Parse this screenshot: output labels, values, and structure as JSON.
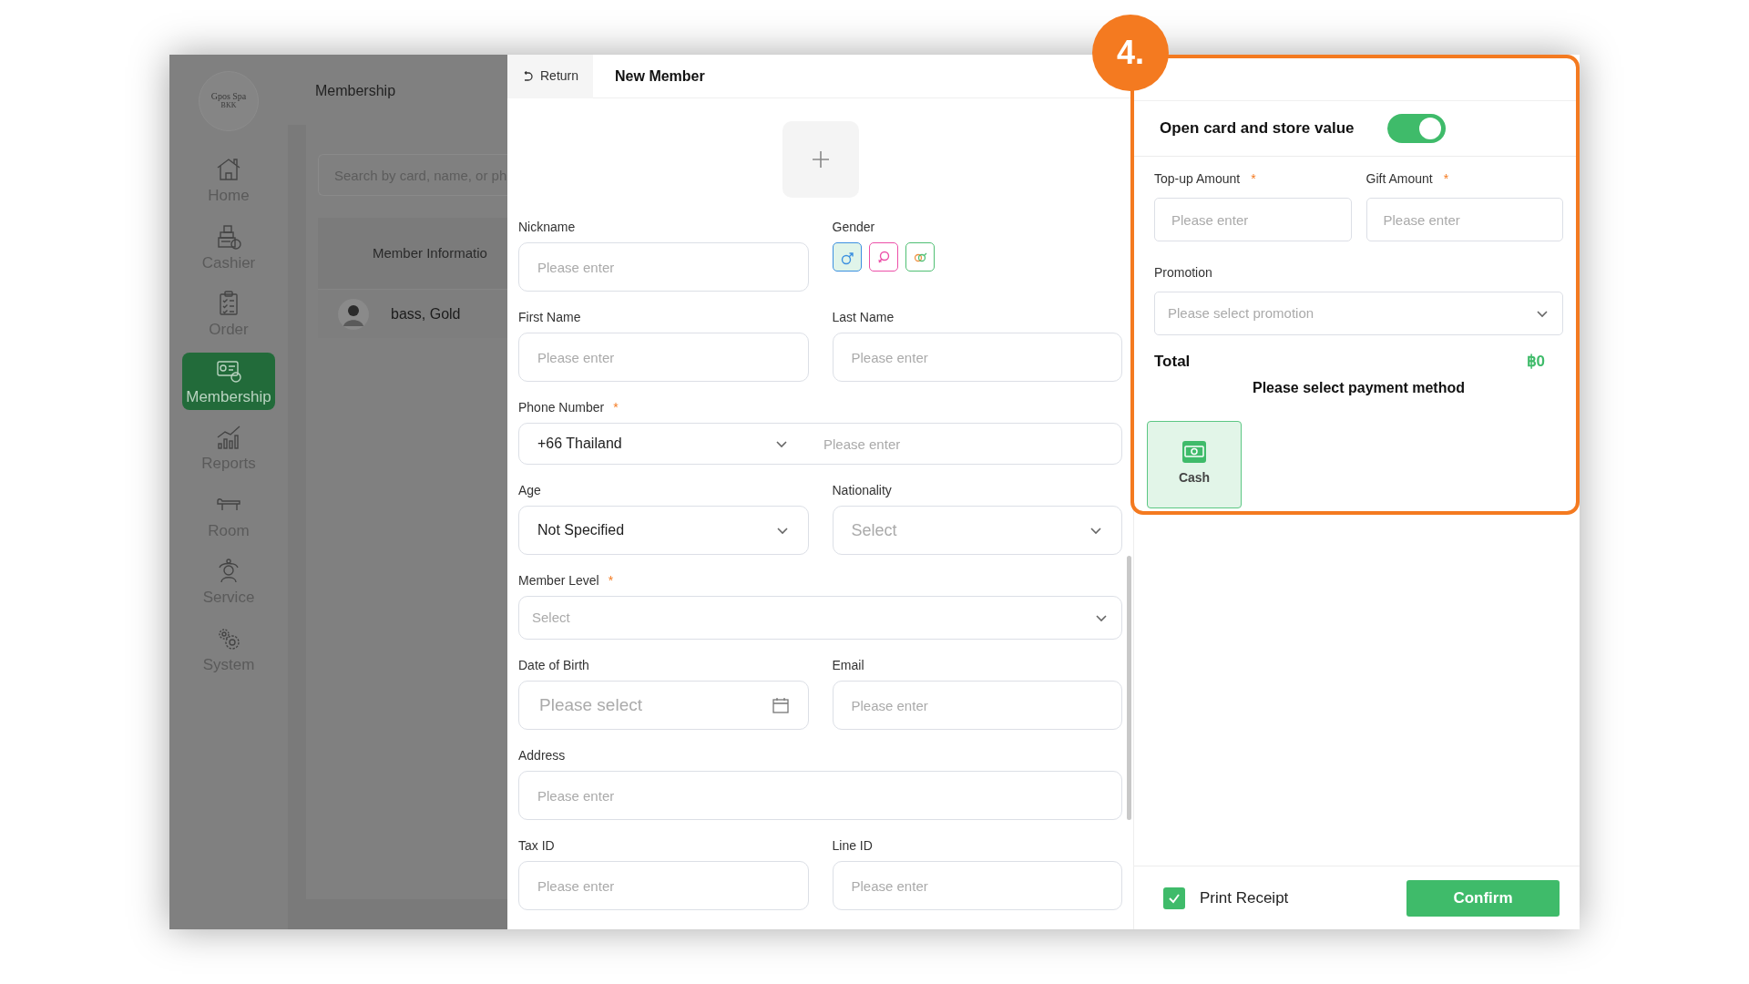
{
  "sidebar": {
    "logo": {
      "title": "Gpos Spa",
      "subtitle": "BKK"
    },
    "items": [
      {
        "kind": "home",
        "label": "Home",
        "selected": false
      },
      {
        "kind": "cashier",
        "label": "Cashier",
        "selected": false
      },
      {
        "kind": "order",
        "label": "Order",
        "selected": false
      },
      {
        "kind": "membership",
        "label": "Membership",
        "selected": true
      },
      {
        "kind": "reports",
        "label": "Reports",
        "selected": false
      },
      {
        "kind": "room",
        "label": "Room",
        "selected": false
      },
      {
        "kind": "service",
        "label": "Service",
        "selected": false
      },
      {
        "kind": "system",
        "label": "System",
        "selected": false
      }
    ]
  },
  "background_page": {
    "title": "Membership",
    "search": {
      "placeholder": "Search by card, name, or ph"
    },
    "table": {
      "columns": [
        "Member Informatio"
      ],
      "rows": [
        {
          "name": "bass, Gold"
        }
      ]
    }
  },
  "form": {
    "return_label": "Return",
    "title": "New Member",
    "rows": [
      {
        "fields": [
          {
            "kind": "text",
            "label": "Nickname",
            "placeholder": "Please enter"
          },
          {
            "kind": "gender",
            "label": "Gender",
            "options": [
              {
                "kind": "male",
                "selected": true,
                "color": "#3b8fe0"
              },
              {
                "kind": "female",
                "selected": false,
                "color": "#ec4fa8"
              },
              {
                "kind": "other",
                "selected": false,
                "color": "#4fbf73"
              }
            ]
          }
        ]
      },
      {
        "fields": [
          {
            "kind": "text",
            "label": "First Name",
            "placeholder": "Please enter"
          },
          {
            "kind": "text",
            "label": "Last Name",
            "placeholder": "Please enter"
          }
        ]
      },
      {
        "fields": [
          {
            "kind": "phone",
            "label": "Phone Number",
            "required_mark": "*",
            "country": "+66 Thailand",
            "placeholder": "Please enter"
          }
        ]
      },
      {
        "fields": [
          {
            "kind": "select",
            "label": "Age",
            "value": "Not Specified"
          },
          {
            "kind": "select",
            "label": "Nationality",
            "placeholder": "Select"
          }
        ]
      },
      {
        "fields": [
          {
            "kind": "select",
            "label": "Member Level",
            "required_mark": "*",
            "placeholder": "Select"
          }
        ]
      },
      {
        "fields": [
          {
            "kind": "date",
            "label": "Date of Birth",
            "placeholder": "Please select"
          },
          {
            "kind": "text",
            "label": "Email",
            "placeholder": "Please enter"
          }
        ]
      },
      {
        "fields": [
          {
            "kind": "text",
            "label": "Address",
            "placeholder": "Please enter"
          }
        ]
      },
      {
        "fields": [
          {
            "kind": "text",
            "label": "Tax ID",
            "placeholder": "Please enter"
          },
          {
            "kind": "text",
            "label": "Line ID",
            "placeholder": "Please enter"
          }
        ]
      }
    ]
  },
  "payment": {
    "badge": "4.",
    "toggle": {
      "label": "Open card and store value",
      "on": true
    },
    "amounts": [
      {
        "label": "Top-up Amount",
        "required_mark": "*",
        "placeholder": "Please enter"
      },
      {
        "label": "Gift Amount",
        "required_mark": "*",
        "placeholder": "Please enter"
      }
    ],
    "promotion": {
      "label": "Promotion",
      "placeholder": "Please select promotion"
    },
    "total": {
      "label": "Total",
      "value": "฿0"
    },
    "prompt": "Please select payment method",
    "methods": [
      {
        "kind": "cash",
        "label": "Cash",
        "selected": true
      }
    ],
    "print_receipt": {
      "label": "Print Receipt",
      "checked": true
    },
    "confirm": "Confirm"
  }
}
